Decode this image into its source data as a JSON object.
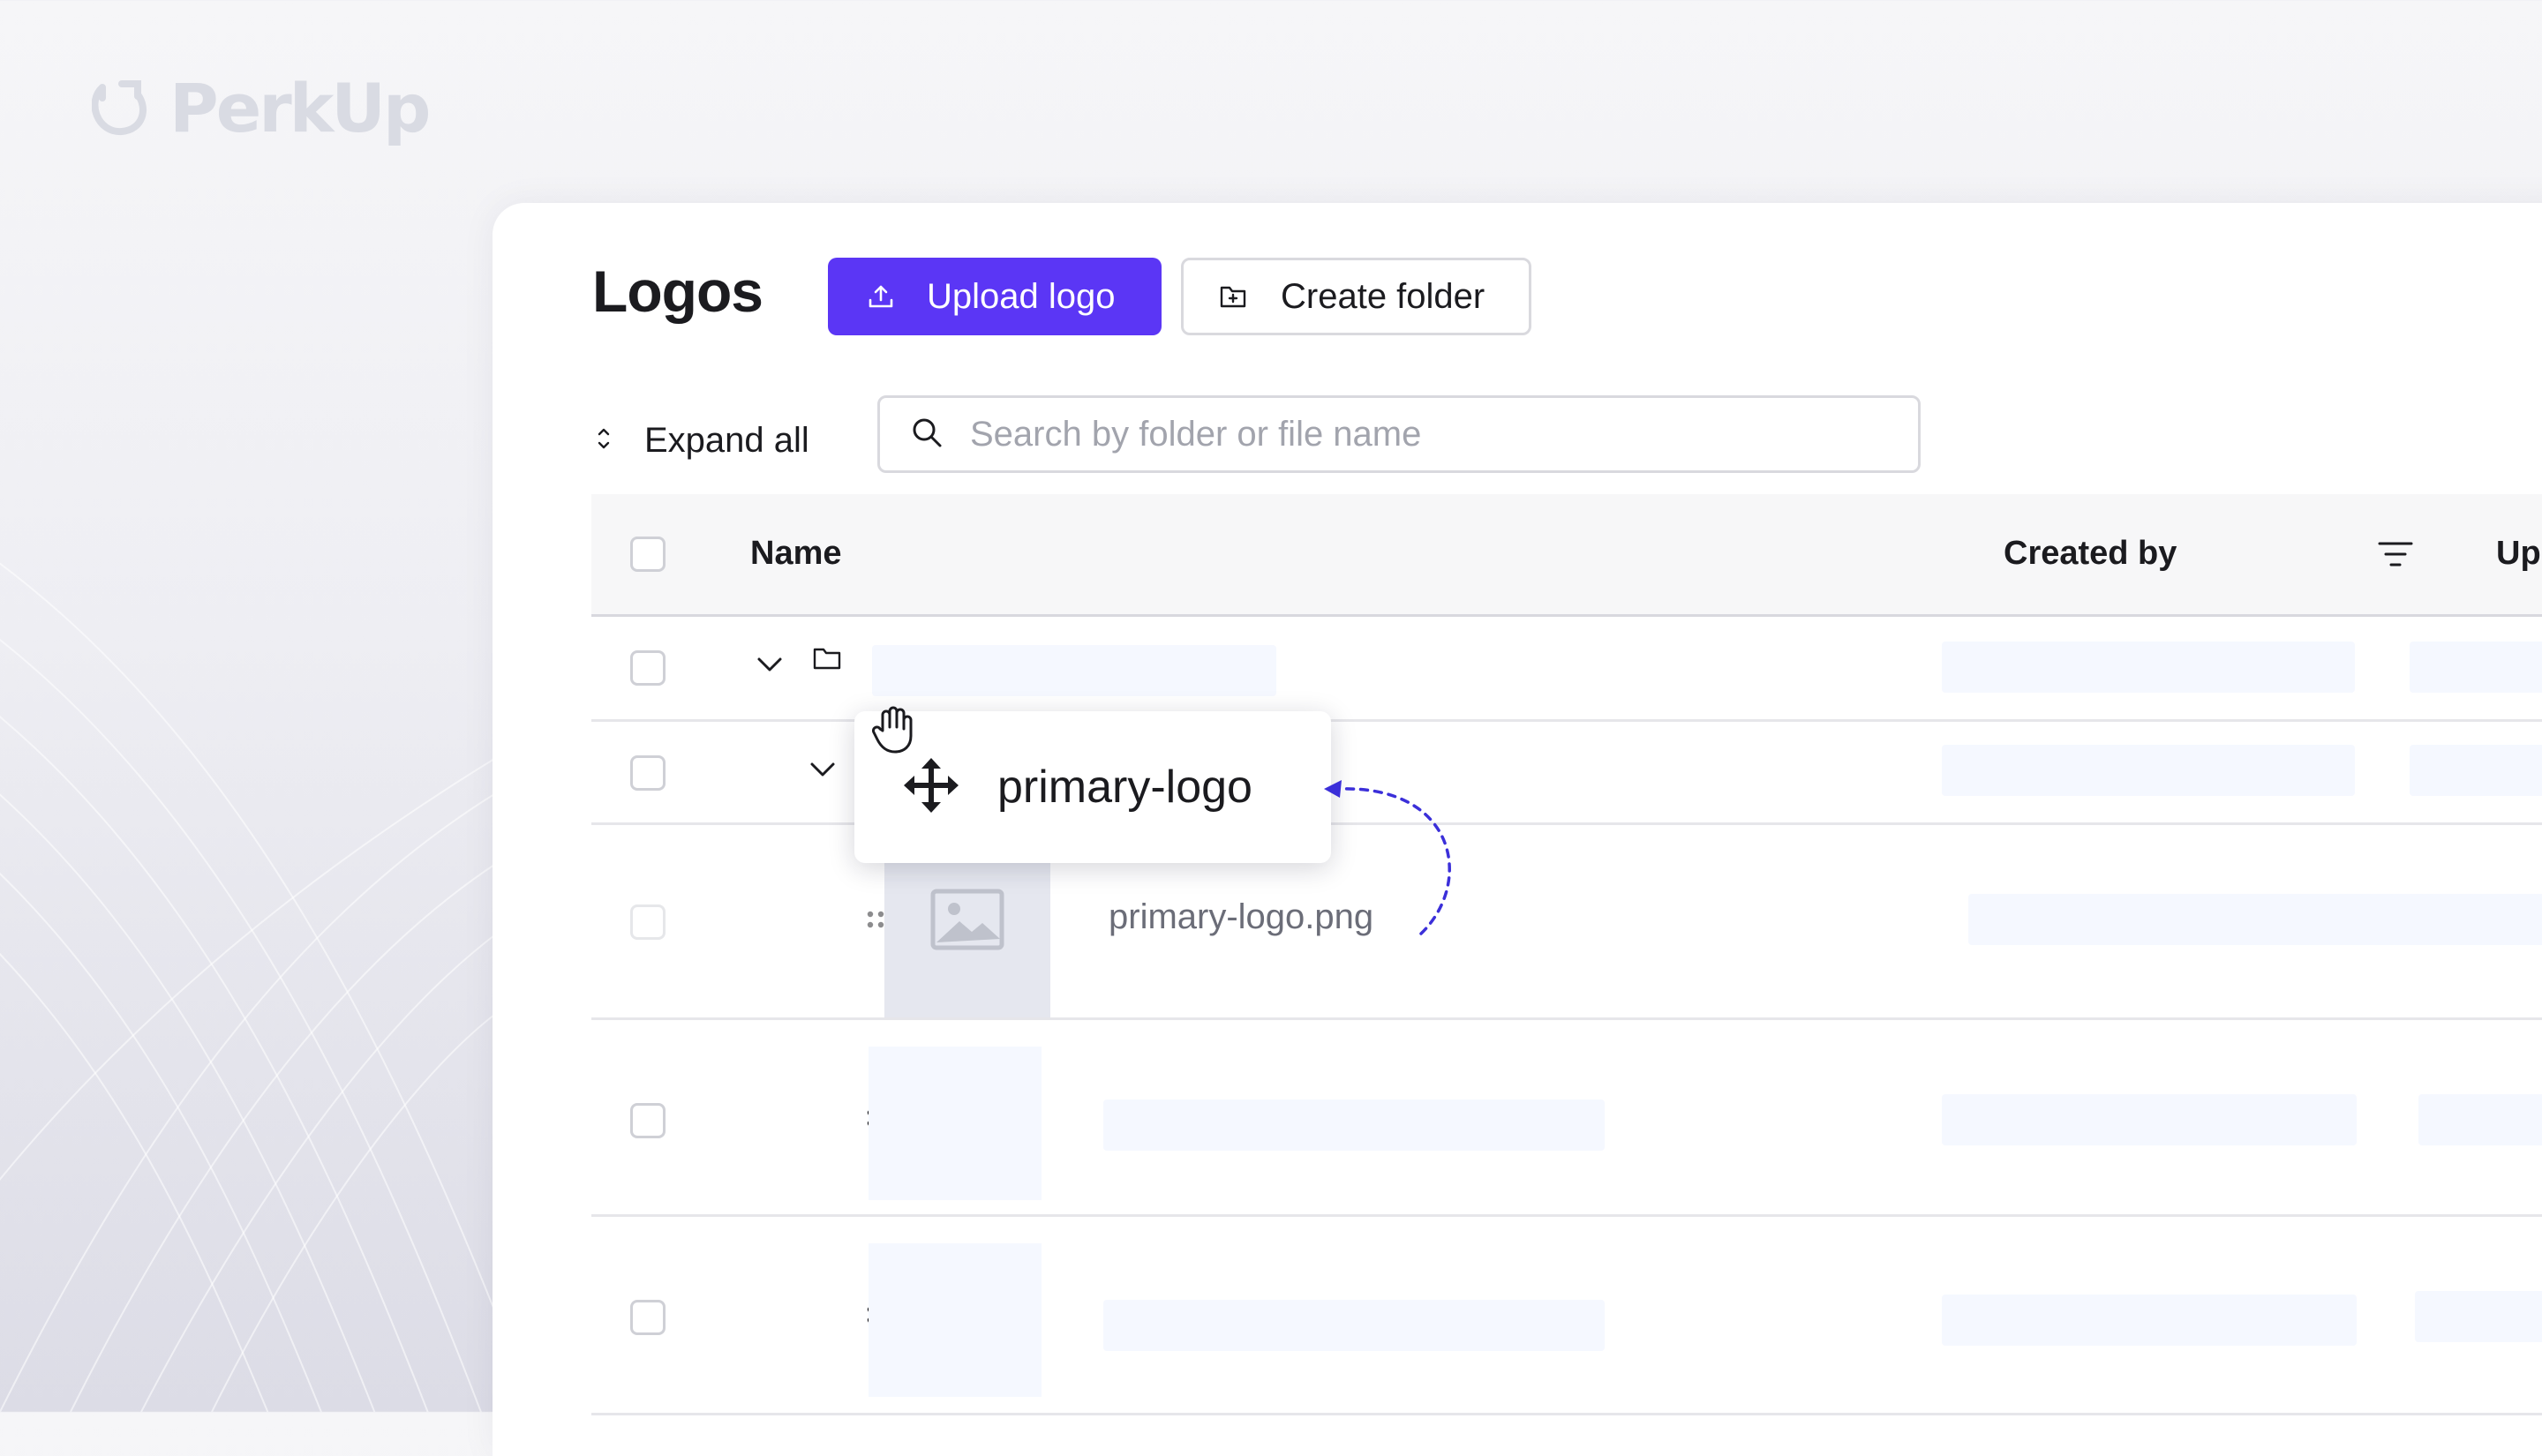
{
  "brand": {
    "name": "PerkUp"
  },
  "page": {
    "title": "Logos"
  },
  "toolbar": {
    "upload_label": "Upload logo",
    "create_folder_label": "Create folder",
    "expand_all_label": "Expand all",
    "search_placeholder": "Search by folder or file name"
  },
  "table": {
    "columns": {
      "name": "Name",
      "created_by": "Created by",
      "updated": "Up"
    },
    "rows": [
      {
        "type": "folder",
        "level": 0,
        "expanded": true
      },
      {
        "type": "folder",
        "level": 1,
        "expanded": true
      },
      {
        "type": "file",
        "name": "primary-logo.png",
        "dragging": true
      },
      {
        "type": "file-placeholder"
      },
      {
        "type": "file-placeholder"
      }
    ]
  },
  "drag": {
    "label": "primary-logo"
  },
  "colors": {
    "accent": "#5b36f5",
    "skeleton": "#f5f8ff",
    "text": "#1b1b1f",
    "muted": "#6b6d78"
  },
  "icons": [
    "upload-icon",
    "folder-plus-icon",
    "chevron-up-down-icon",
    "search-icon",
    "filter-icon",
    "chevron-down-icon",
    "folder-icon",
    "grip-icon",
    "image-icon",
    "move-icon",
    "hand-cursor-icon"
  ]
}
